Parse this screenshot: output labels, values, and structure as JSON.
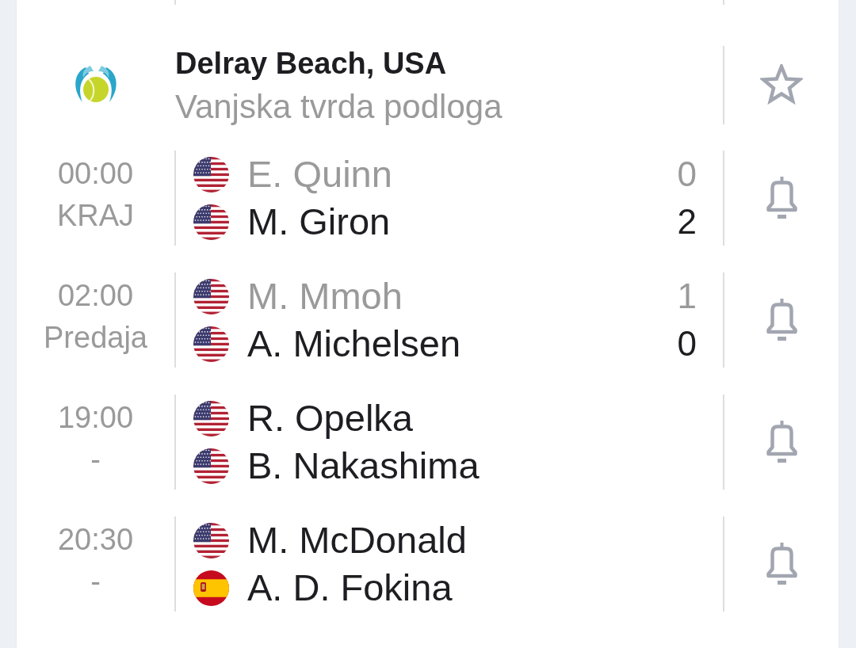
{
  "tournament": {
    "name": "Delray Beach, USA",
    "surface": "Vanjska tvrda podloga",
    "favorite": false
  },
  "matches": [
    {
      "time": "00:00",
      "status": "KRAJ",
      "alert": false,
      "players": [
        {
          "name": "E. Quinn",
          "kind": "usa",
          "lost": true,
          "score": "0"
        },
        {
          "name": "M. Giron",
          "kind": "usa",
          "lost": false,
          "score": "2"
        }
      ]
    },
    {
      "time": "02:00",
      "status": "Predaja",
      "alert": false,
      "players": [
        {
          "name": "M. Mmoh",
          "kind": "usa",
          "lost": true,
          "score": "1"
        },
        {
          "name": "A. Michelsen",
          "kind": "usa",
          "lost": false,
          "score": "0"
        }
      ]
    },
    {
      "time": "19:00",
      "status": "-",
      "alert": false,
      "players": [
        {
          "name": "R. Opelka",
          "kind": "usa",
          "lost": false
        },
        {
          "name": "B. Nakashima",
          "kind": "usa",
          "lost": false
        }
      ]
    },
    {
      "time": "20:30",
      "status": "-",
      "alert": false,
      "players": [
        {
          "name": "M. McDonald",
          "kind": "usa",
          "lost": false
        },
        {
          "name": "A. D. Fokina",
          "kind": "spain",
          "lost": false
        }
      ]
    }
  ]
}
